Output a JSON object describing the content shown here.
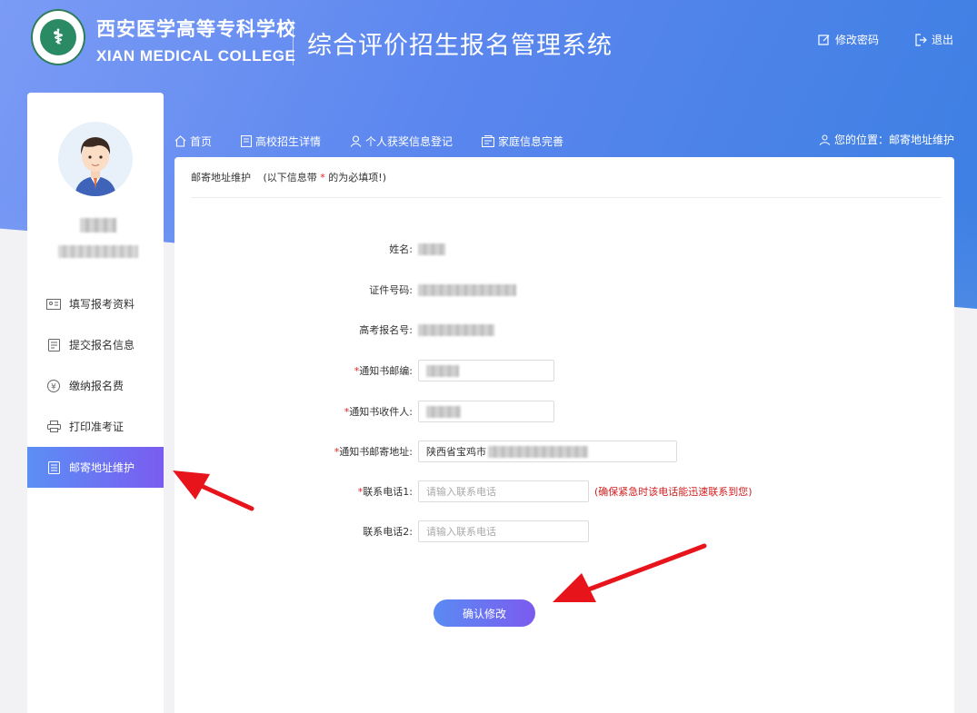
{
  "header": {
    "school_cn": "西安医学高等专科学校",
    "school_en": "XIAN MEDICAL COLLEGE",
    "system_title": "综合评价招生报名管理系统",
    "change_password": "修改密码",
    "logout": "退出"
  },
  "sidebar": {
    "items": [
      {
        "label": "填写报考资料",
        "icon": "id-card-icon"
      },
      {
        "label": "提交报名信息",
        "icon": "form-icon"
      },
      {
        "label": "缴纳报名费",
        "icon": "yuan-icon"
      },
      {
        "label": "打印准考证",
        "icon": "printer-icon"
      },
      {
        "label": "邮寄地址维护",
        "icon": "list-icon",
        "active": true
      }
    ]
  },
  "nav": {
    "items": [
      {
        "label": "首页",
        "icon": "home-icon"
      },
      {
        "label": "高校招生详情",
        "icon": "document-icon"
      },
      {
        "label": "个人获奖信息登记",
        "icon": "user-icon"
      },
      {
        "label": "家庭信息完善",
        "icon": "family-icon"
      }
    ],
    "breadcrumb": "您的位置：邮寄地址维护"
  },
  "form": {
    "title": "邮寄地址维护",
    "note_prefix": "(以下信息带",
    "note_star": "*",
    "note_suffix": "的为必填项!)",
    "name_label": "姓名:",
    "id_label": "证件号码:",
    "exam_no_label": "高考报名号:",
    "postcode_label": "通知书邮编:",
    "recipient_label": "通知书收件人:",
    "address_label": "通知书邮寄地址:",
    "address_value": "陕西省宝鸡市",
    "phone1_label": "联系电话1:",
    "phone1_placeholder": "请输入联系电话",
    "phone1_hint": "(确保紧急时该电话能迅速联系到您)",
    "phone2_label": "联系电话2:",
    "phone2_placeholder": "请输入联系电话",
    "required_mark": "*",
    "submit_label": "确认修改"
  },
  "colors": {
    "accent_start": "#5a8bf3",
    "accent_end": "#7c5bef",
    "required": "#e02020",
    "annotation_arrow": "#e8141c"
  }
}
